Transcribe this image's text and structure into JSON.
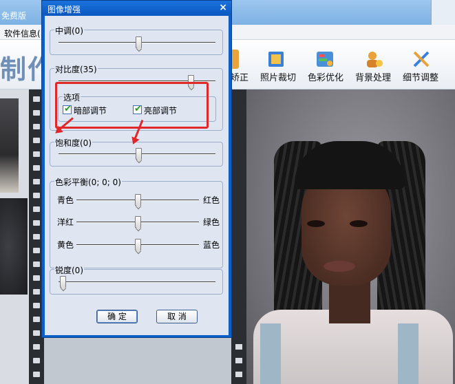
{
  "app": {
    "title_fragment": "免费版",
    "menu": {
      "software_info": "软件信息("
    },
    "big_title": "制作",
    "toolbar": {
      "items": [
        {
          "label": "矫正",
          "icon": "correct-icon"
        },
        {
          "label": "照片裁切",
          "icon": "crop-icon"
        },
        {
          "label": "色彩优化",
          "icon": "color-optimize-icon"
        },
        {
          "label": "背景处理",
          "icon": "background-icon"
        },
        {
          "label": "细节调整",
          "icon": "detail-adjust-icon"
        }
      ]
    }
  },
  "dialog": {
    "title": "图像增强",
    "close_symbol": "×",
    "midtone": {
      "label": "中调(0)",
      "value": 0,
      "min": -100,
      "max": 100
    },
    "contrast": {
      "label": "对比度(35)",
      "value": 35,
      "min": -100,
      "max": 100
    },
    "options": {
      "label": "选项",
      "dark_adjust": {
        "label": "暗部调节",
        "checked": true
      },
      "bright_adjust": {
        "label": "亮部调节",
        "checked": true
      }
    },
    "saturation": {
      "label": "饱和度(0)",
      "value": 0,
      "min": -100,
      "max": 100
    },
    "color_balance": {
      "label": "色彩平衡(0; 0; 0)",
      "rows": [
        {
          "left": "青色",
          "right": "红色",
          "value": 0
        },
        {
          "left": "洋红",
          "right": "绿色",
          "value": 0
        },
        {
          "left": "黄色",
          "right": "蓝色",
          "value": 0
        }
      ]
    },
    "sharpness": {
      "label": "锐度(0)",
      "value": 0,
      "min": 0,
      "max": 100
    },
    "ok_label": "确 定",
    "cancel_label": "取 消"
  },
  "colors": {
    "dialog_frame": "#0b5fc8",
    "dialog_body": "#dfe6f1",
    "annotation_red": "#e0282a",
    "check_green": "#21a121"
  }
}
